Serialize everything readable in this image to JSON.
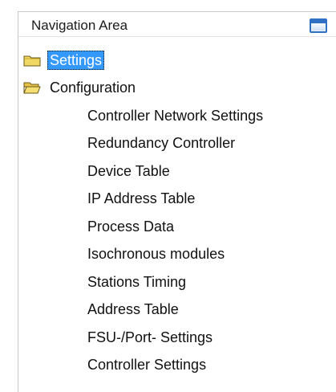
{
  "panel": {
    "title": "Navigation Area",
    "restore_icon": "window-icon"
  },
  "tree": {
    "root_items": [
      {
        "label": "Settings",
        "icon": "folder-closed-icon",
        "selected": true
      },
      {
        "label": "Configuration",
        "icon": "folder-open-icon",
        "selected": false
      }
    ],
    "configuration_children": [
      {
        "label": "Controller Network Settings"
      },
      {
        "label": "Redundancy Controller"
      },
      {
        "label": "Device Table"
      },
      {
        "label": "IP Address Table"
      },
      {
        "label": "Process Data"
      },
      {
        "label": "Isochronous modules"
      },
      {
        "label": "Stations Timing"
      },
      {
        "label": "Address Table"
      },
      {
        "label": "FSU-/Port- Settings"
      },
      {
        "label": "Controller Settings"
      }
    ]
  },
  "colors": {
    "selection_background": "#3399ff",
    "selection_text": "#ffffff",
    "folder_yellow": "#e8c84a",
    "window_icon_blue": "#2f6fc4"
  }
}
